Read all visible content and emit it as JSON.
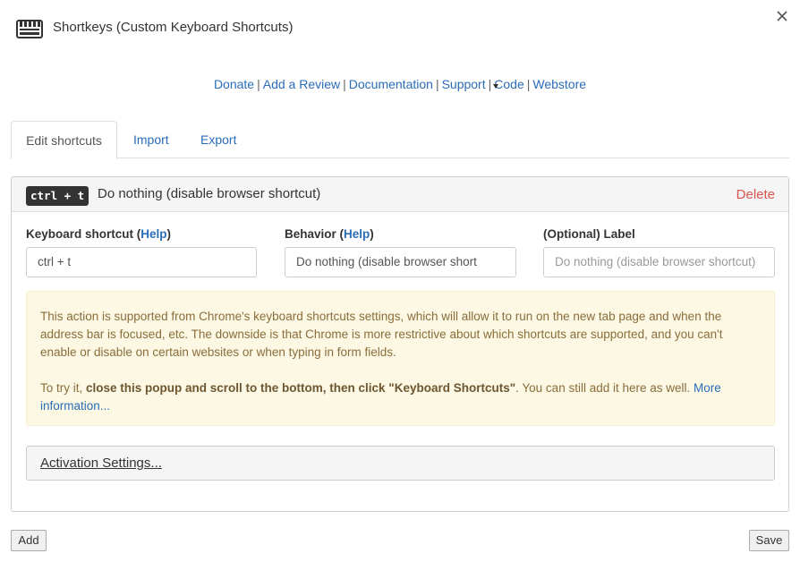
{
  "app": {
    "title": "Shortkeys (Custom Keyboard Shortcuts)",
    "icon": "keyboard-icon"
  },
  "links": [
    "Donate",
    "Add a Review",
    "Documentation",
    "Support",
    "Code",
    "Webstore"
  ],
  "link_separator": "|",
  "tabs": [
    {
      "label": "Edit shortcuts",
      "active": true
    },
    {
      "label": "Import",
      "active": false
    },
    {
      "label": "Export",
      "active": false
    }
  ],
  "shortcut": {
    "keys": "ctrl + t",
    "title": "Do nothing (disable browser shortcut)",
    "delete_label": "Delete",
    "fields": {
      "shortcut_label": "Keyboard shortcut",
      "behavior_label": "Behavior",
      "help_label": "Help",
      "optional_label": "(Optional) Label",
      "shortcut_value": "ctrl + t",
      "behavior_value": "Do nothing (disable browser short",
      "label_placeholder": "Do nothing (disable browser shortcut)"
    },
    "alert": {
      "paragraph1": "This action is supported from Chrome's keyboard shortcuts settings, which will allow it to run on the new tab page and when the address bar is focused, etc. The downside is that Chrome is more restrictive about which shortcuts are supported, and you can't enable or disable on certain websites or when typing in form fields.",
      "try_prefix": "To try it,",
      "try_bold": "close this popup and scroll to the bottom, then click \"Keyboard Shortcuts\"",
      "try_suffix": ". You can still add it here as well.",
      "more_link": "More information..."
    },
    "activation_label": "Activation Settings..."
  },
  "buttons": {
    "add": "Add",
    "save": "Save"
  },
  "colors": {
    "link": "#2a6cb8",
    "delete": "#d9534f",
    "alert_bg": "#fcf8e3",
    "alert_text": "#8a6d3b"
  }
}
